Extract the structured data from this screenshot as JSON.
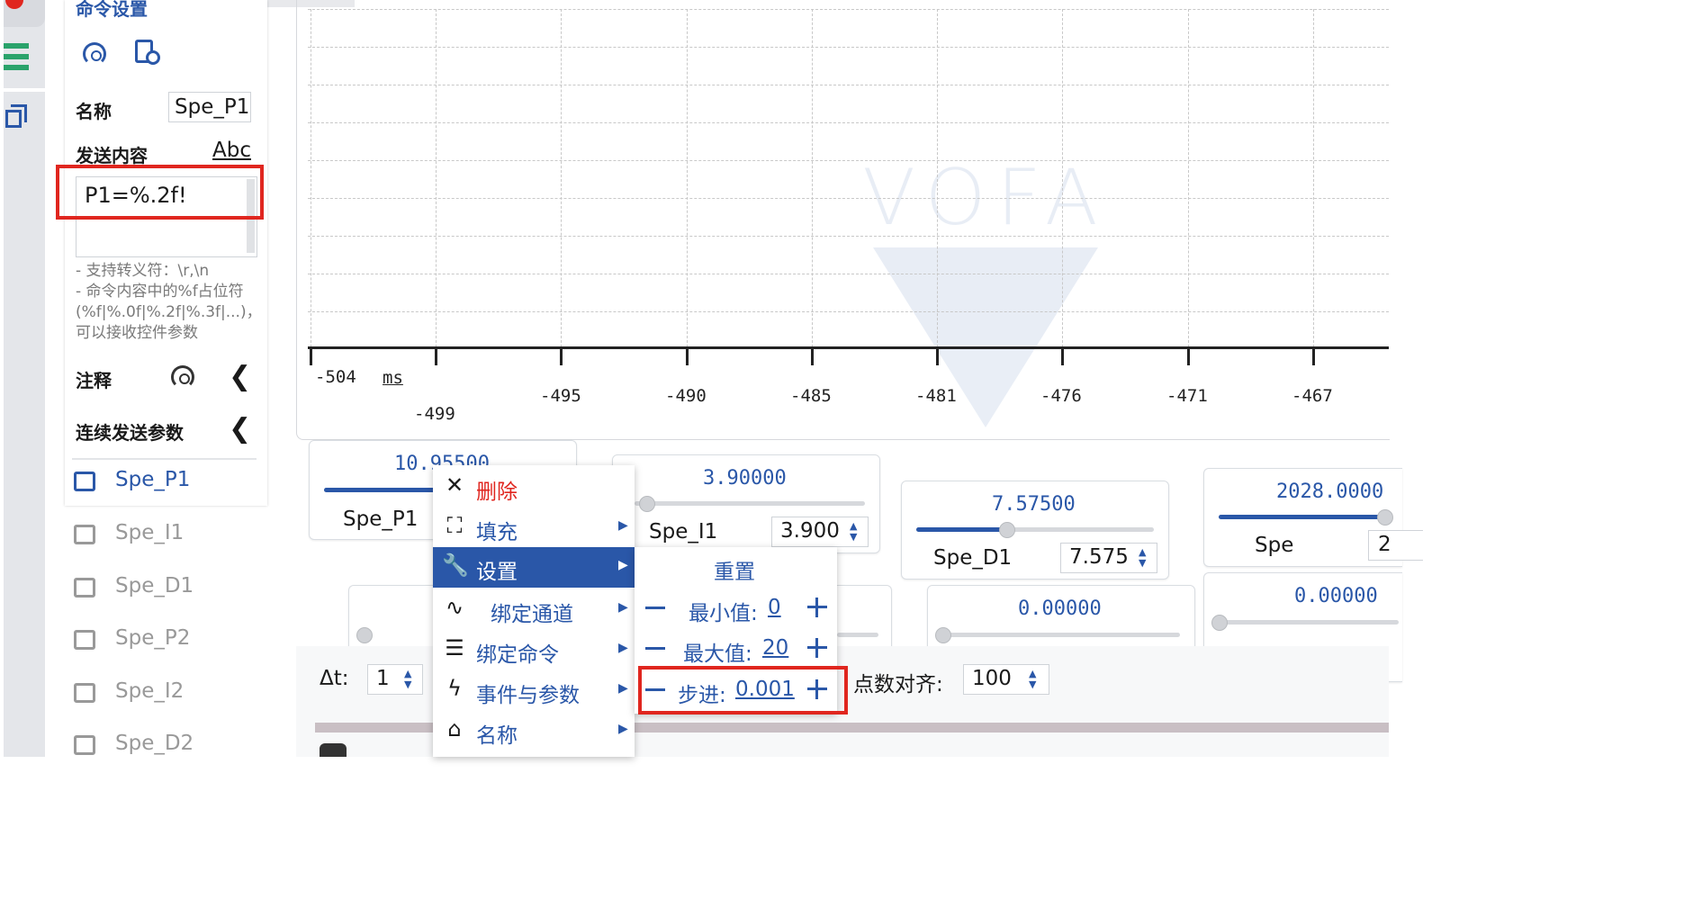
{
  "panel": {
    "title": "命令设置",
    "name_label": "名称",
    "name_value": "Spe_P1",
    "send_label": "发送内容",
    "send_mode": "Abc",
    "send_value": "P1=%.2f!",
    "hint_lines": [
      "- 支持转义符：\\r,\\n",
      "- 命令内容中的%f占位符",
      "(%f|%.0f|%.2f|%.3f|...)，",
      "可以接收控件参数"
    ],
    "comment_label": "注释",
    "continuous_label": "连续发送参数"
  },
  "commands": [
    "Spe_P1",
    "Spe_I1",
    "Spe_D1",
    "Spe_P2",
    "Spe_I2",
    "Spe_D2"
  ],
  "chart": {
    "unit": "ms",
    "ticks_top": [
      "-504",
      "-495",
      "-490",
      "-485",
      "-481",
      "-476",
      "-471",
      "-467"
    ],
    "ticks_low": [
      "-499"
    ],
    "watermark": "VOFA"
  },
  "cards": [
    {
      "value": "10.95500",
      "name": "Spe_P1",
      "fill": 0.55
    },
    {
      "value": "3.90000",
      "name": "Spe_I1",
      "input": "3.900",
      "fill": 0.05
    },
    {
      "value": "7.57500",
      "name": "Spe_D1",
      "input": "7.575",
      "fill": 0.38
    },
    {
      "value": "2028.0000",
      "name": "Spe",
      "input": "2",
      "fill": 0.97
    },
    {
      "value": "0.00000"
    },
    {
      "value": "0.00000"
    }
  ],
  "bottom": {
    "dt_label": "Δt:",
    "dt_value": "1",
    "align_label": "点数对齐:",
    "align_value": "100"
  },
  "menu": {
    "items": [
      {
        "label": "删除",
        "icon": "close-icon",
        "glyph": "✕",
        "danger": true
      },
      {
        "label": "填充",
        "icon": "expand-icon",
        "glyph": "⛶",
        "arrow": true
      },
      {
        "label": "设置",
        "icon": "wrench-icon",
        "glyph": "🔧",
        "arrow": true,
        "selected": true
      },
      {
        "label": "绑定通道",
        "icon": "waveform-icon",
        "glyph": "∿",
        "arrow": true
      },
      {
        "label": "绑定命令",
        "icon": "list-icon",
        "glyph": "☰",
        "arrow": true
      },
      {
        "label": "事件与参数",
        "icon": "bolt-icon",
        "glyph": "ϟ",
        "arrow": true
      },
      {
        "label": "名称",
        "icon": "tag-icon",
        "glyph": "⌂",
        "arrow": true
      }
    ],
    "submenu": {
      "reset": "重置",
      "min_label": "最小值:",
      "min_value": "0",
      "max_label": "最大值:",
      "max_value": "20",
      "step_label": "步进:",
      "step_value": "0.001"
    }
  },
  "colors": {
    "accent": "#2a57a8",
    "highlight": "#e0261f",
    "danger": "#e0261f"
  }
}
